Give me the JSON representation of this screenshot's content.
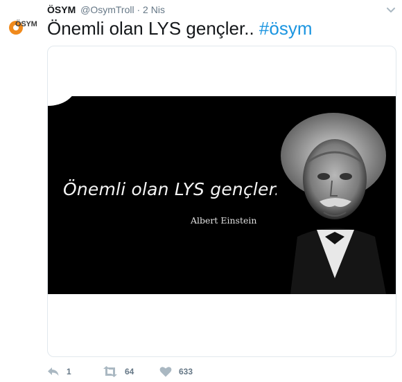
{
  "tweet": {
    "avatar_logo_text": "ÖSYM",
    "display_name": "ÖSYM",
    "handle": "@OsymTroll",
    "separator": "·",
    "timestamp": "2 Nis",
    "text": "Önemli olan LYS gençler..",
    "hashtag": "#ösym"
  },
  "media": {
    "quote": "Önemli olan LYS gençler..",
    "attribution": "Albert Einstein"
  },
  "actions": {
    "reply_count": "1",
    "retweet_count": "64",
    "like_count": "633"
  },
  "colors": {
    "hashtag": "#1b95e0",
    "muted": "#657786",
    "brand_orange": "#f08a1c"
  }
}
